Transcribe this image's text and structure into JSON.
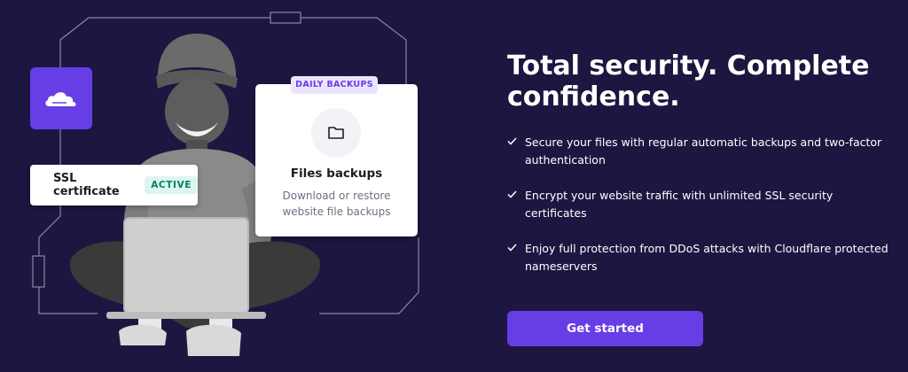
{
  "colors": {
    "background": "#1d1640",
    "accent": "#673de6",
    "card": "#ffffff",
    "active_badge_bg": "#def4f0",
    "active_badge_text": "#008361",
    "daily_badge_bg": "#ebe4ff"
  },
  "illustration": {
    "cloudflare_tile": {
      "icon": "cloudflare-cloud-icon"
    },
    "ssl_card": {
      "label": "SSL certificate",
      "badge": "ACTIVE"
    },
    "backup_card": {
      "badge": "DAILY BACKUPS",
      "icon": "folder-icon",
      "title": "Files backups",
      "description": "Download or restore website file backups"
    }
  },
  "content": {
    "headline": "Total security. Complete confidence.",
    "features": [
      {
        "icon": "check-icon",
        "text": "Secure your files with regular automatic backups and two-factor authentication"
      },
      {
        "icon": "check-icon",
        "text": "Encrypt your website traffic with unlimited SSL security certificates"
      },
      {
        "icon": "check-icon",
        "text": "Enjoy full protection from DDoS attacks with Cloudflare protected nameservers"
      }
    ],
    "cta_label": "Get started"
  }
}
